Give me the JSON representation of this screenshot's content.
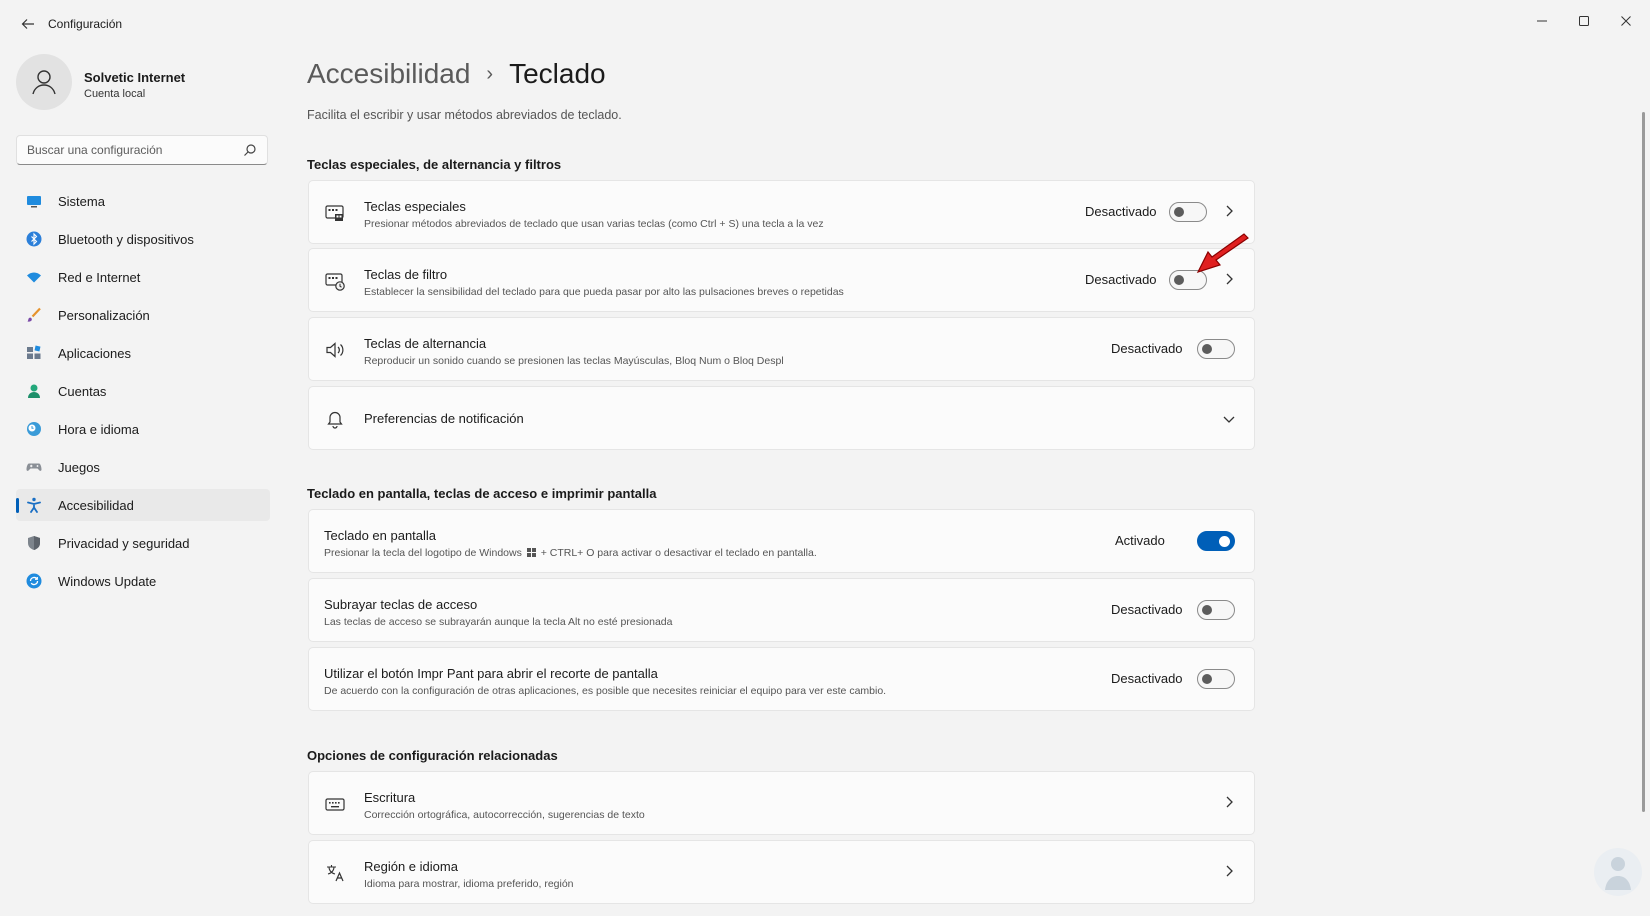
{
  "window": {
    "title": "Configuración",
    "controls": {
      "minimize": "minimize-icon",
      "maximize": "maximize-icon",
      "close": "close-icon"
    }
  },
  "user": {
    "name": "Solvetic Internet",
    "account_type": "Cuenta local"
  },
  "search": {
    "placeholder": "Buscar una configuración"
  },
  "sidebar": {
    "items": [
      {
        "label": "Sistema",
        "icon": "monitor-icon"
      },
      {
        "label": "Bluetooth y dispositivos",
        "icon": "bluetooth-icon"
      },
      {
        "label": "Red e Internet",
        "icon": "wifi-icon"
      },
      {
        "label": "Personalización",
        "icon": "brush-icon"
      },
      {
        "label": "Aplicaciones",
        "icon": "apps-icon"
      },
      {
        "label": "Cuentas",
        "icon": "person-icon"
      },
      {
        "label": "Hora e idioma",
        "icon": "clock-globe-icon"
      },
      {
        "label": "Juegos",
        "icon": "gamepad-icon"
      },
      {
        "label": "Accesibilidad",
        "icon": "accessibility-icon",
        "selected": true
      },
      {
        "label": "Privacidad y seguridad",
        "icon": "shield-icon"
      },
      {
        "label": "Windows Update",
        "icon": "update-icon"
      }
    ]
  },
  "breadcrumb": {
    "parent": "Accesibilidad",
    "separator": "›",
    "current": "Teclado"
  },
  "page": {
    "description": "Facilita el escribir y usar métodos abreviados de teclado."
  },
  "sections": {
    "special": {
      "title": "Teclas especiales, de alternancia y filtros",
      "items": [
        {
          "title": "Teclas especiales",
          "subtitle": "Presionar métodos abreviados de teclado que usan varias teclas (como Ctrl + S) una tecla a la vez",
          "state": "Desactivado",
          "on": false,
          "icon": "sticky-keys-icon"
        },
        {
          "title": "Teclas de filtro",
          "subtitle": "Establecer la sensibilidad del teclado para que pueda pasar por alto las pulsaciones breves o repetidas",
          "state": "Desactivado",
          "on": false,
          "icon": "filter-keys-icon"
        },
        {
          "title": "Teclas de alternancia",
          "subtitle": "Reproducir un sonido cuando se presionen las teclas Mayúsculas, Bloq Num o Bloq Despl",
          "state": "Desactivado",
          "on": false,
          "icon": "speaker-icon"
        },
        {
          "title": "Preferencias de notificación",
          "icon": "bell-icon"
        }
      ]
    },
    "onscreen": {
      "title": "Teclado en pantalla, teclas de acceso e imprimir pantalla",
      "items": [
        {
          "title": "Teclado en pantalla",
          "subtitle_pre": "Presionar la tecla del logotipo de Windows",
          "subtitle_post": "+ CTRL+ O para activar o desactivar el teclado en pantalla.",
          "state": "Activado",
          "on": true
        },
        {
          "title": "Subrayar teclas de acceso",
          "subtitle": "Las teclas de acceso se subrayarán aunque la tecla Alt no esté presionada",
          "state": "Desactivado",
          "on": false
        },
        {
          "title": "Utilizar el botón Impr Pant para abrir el recorte de pantalla",
          "subtitle": "De acuerdo con la configuración de otras aplicaciones, es posible que necesites reiniciar el equipo para ver este cambio.",
          "state": "Desactivado",
          "on": false
        }
      ]
    },
    "related": {
      "title": "Opciones de configuración relacionadas",
      "items": [
        {
          "title": "Escritura",
          "subtitle": "Corrección ortográfica, autocorrección, sugerencias de texto",
          "icon": "keyboard-icon"
        },
        {
          "title": "Región e idioma",
          "subtitle": "Idioma para mostrar, idioma preferido, región",
          "icon": "language-icon"
        }
      ]
    }
  },
  "colors": {
    "accent": "#005fb8",
    "background": "#f3f3f3",
    "card": "#fbfbfb",
    "annotation_arrow": "#e02020"
  }
}
